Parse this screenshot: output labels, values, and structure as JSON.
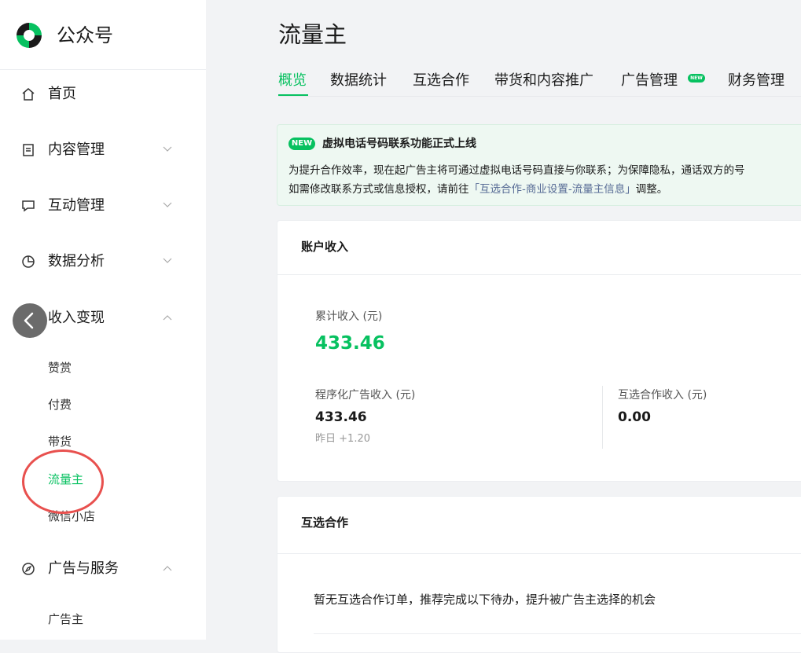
{
  "brand": {
    "name": "公众号"
  },
  "sidebar": {
    "items": [
      {
        "label": "首页",
        "icon": "home-icon"
      },
      {
        "label": "内容管理",
        "icon": "document-icon",
        "expanded": false
      },
      {
        "label": "互动管理",
        "icon": "chat-icon",
        "expanded": false
      },
      {
        "label": "数据分析",
        "icon": "pie-chart-icon",
        "expanded": false
      },
      {
        "label": "收入变现",
        "icon": "money-icon",
        "expanded": true,
        "children": [
          "赞赏",
          "付费",
          "带货",
          "流量主",
          "微信小店"
        ],
        "active_child": "流量主"
      },
      {
        "label": "广告与服务",
        "icon": "compass-icon",
        "expanded": true,
        "children": [
          "广告主"
        ]
      }
    ]
  },
  "page": {
    "title": "流量主",
    "tabs": [
      "概览",
      "数据统计",
      "互选合作",
      "带货和内容推广",
      "广告管理",
      "财务管理"
    ],
    "active_tab": "概览",
    "tab_badge": "NEW"
  },
  "notice": {
    "badge": "NEW",
    "title": "虚拟电话号码联系功能正式上线",
    "line1": "为提升合作效率，现在起广告主将可通过虚拟电话号码直接与你联系；为保障隐私，通话双方的号",
    "line2_prefix": "如需修改联系方式或信息授权，请前往",
    "line2_link": "「互选合作-商业设置-流量主信息」",
    "line2_suffix": "调整。"
  },
  "income_card": {
    "title": "账户收入",
    "total_label": "累计收入 (元)",
    "total_value": "433.46",
    "programmatic_label": "程序化广告收入 (元)",
    "programmatic_value": "433.46",
    "yesterday_label": "昨日",
    "yesterday_value": "+1.20",
    "mutual_label": "互选合作收入 (元)",
    "mutual_value": "0.00"
  },
  "mutual_card": {
    "title": "互选合作",
    "empty_text": "暂无互选合作订单，推荐完成以下待办，提升被广告主选择的机会"
  },
  "colors": {
    "accent": "#07c160",
    "link": "#576b95",
    "annotation": "#e8504e"
  }
}
